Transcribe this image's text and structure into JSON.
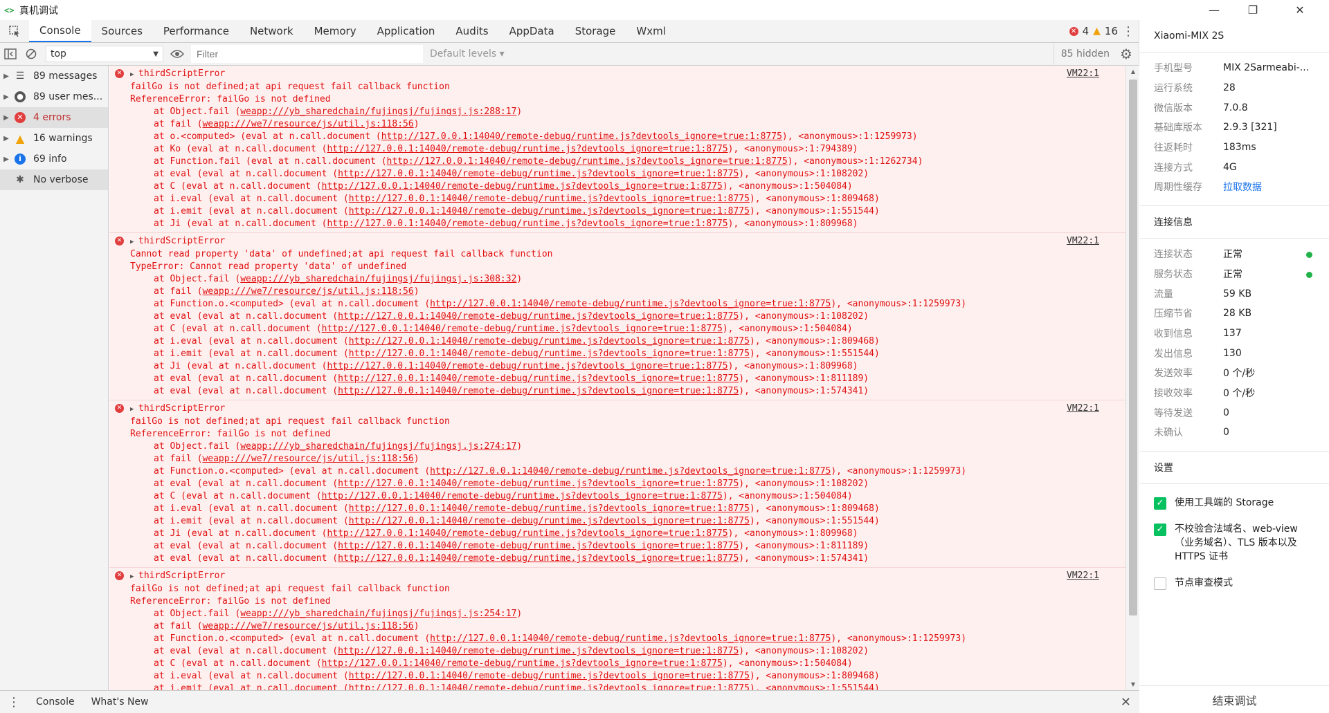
{
  "window": {
    "title": "真机调试",
    "logo_text": "<>",
    "minimize_label": "—",
    "maximize_label": "❐",
    "close_label": "✕"
  },
  "tabs": [
    {
      "label": "Console",
      "active": true
    },
    {
      "label": "Sources"
    },
    {
      "label": "Performance"
    },
    {
      "label": "Network"
    },
    {
      "label": "Memory"
    },
    {
      "label": "Application"
    },
    {
      "label": "Audits"
    },
    {
      "label": "AppData"
    },
    {
      "label": "Storage"
    },
    {
      "label": "Wxml"
    }
  ],
  "counters": {
    "errors": "4",
    "warnings": "16"
  },
  "toolbar": {
    "context": "top",
    "filter_placeholder": "Filter",
    "levels": "Default levels",
    "hidden": "85 hidden"
  },
  "sidebar": {
    "items": [
      {
        "label": "89 messages",
        "icon": "list-icon"
      },
      {
        "label": "89 user mes...",
        "icon": "user-icon"
      },
      {
        "label": "4 errors",
        "icon": "error-icon"
      },
      {
        "label": "16 warnings",
        "icon": "warning-icon"
      },
      {
        "label": "69 info",
        "icon": "info-icon"
      },
      {
        "label": "No verbose",
        "icon": "bug-icon"
      }
    ]
  },
  "messages": [
    {
      "title": "thirdScriptError",
      "source": "VM22:1",
      "lines": [
        "failGo is not defined;at api request fail callback function",
        "ReferenceError: failGo is not defined"
      ],
      "frames": [
        {
          "pre": "at Object.fail (",
          "link": "weapp:///yb_sharedchain/fujingsj/fujingsj.js:288:17",
          "post": ")"
        },
        {
          "pre": "at fail (",
          "link": "weapp:///we7/resource/js/util.js:118:56",
          "post": ")"
        },
        {
          "pre": "at o.<computed> (eval at n.call.document (",
          "link": "http://127.0.0.1:14040/remote-debug/runtime.js?devtools_ignore=true:1:8775",
          "post": "), <anonymous>:1:1259973)"
        },
        {
          "pre": "at Ko (eval at n.call.document (",
          "link": "http://127.0.0.1:14040/remote-debug/runtime.js?devtools_ignore=true:1:8775",
          "post": "), <anonymous>:1:794389)"
        },
        {
          "pre": "at Function.fail (eval at n.call.document (",
          "link": "http://127.0.0.1:14040/remote-debug/runtime.js?devtools_ignore=true:1:8775",
          "post": "), <anonymous>:1:1262734)"
        },
        {
          "pre": "at eval (eval at n.call.document (",
          "link": "http://127.0.0.1:14040/remote-debug/runtime.js?devtools_ignore=true:1:8775",
          "post": "), <anonymous>:1:108202)"
        },
        {
          "pre": "at C (eval at n.call.document (",
          "link": "http://127.0.0.1:14040/remote-debug/runtime.js?devtools_ignore=true:1:8775",
          "post": "), <anonymous>:1:504084)"
        },
        {
          "pre": "at i.eval (eval at n.call.document (",
          "link": "http://127.0.0.1:14040/remote-debug/runtime.js?devtools_ignore=true:1:8775",
          "post": "), <anonymous>:1:809468)"
        },
        {
          "pre": "at i.emit (eval at n.call.document (",
          "link": "http://127.0.0.1:14040/remote-debug/runtime.js?devtools_ignore=true:1:8775",
          "post": "), <anonymous>:1:551544)"
        },
        {
          "pre": "at Ji (eval at n.call.document (",
          "link": "http://127.0.0.1:14040/remote-debug/runtime.js?devtools_ignore=true:1:8775",
          "post": "), <anonymous>:1:809968)"
        }
      ]
    },
    {
      "title": "thirdScriptError",
      "source": "VM22:1",
      "lines": [
        "Cannot read property 'data' of undefined;at api request fail callback function",
        "TypeError: Cannot read property 'data' of undefined"
      ],
      "frames": [
        {
          "pre": "at Object.fail (",
          "link": "weapp:///yb_sharedchain/fujingsj/fujingsj.js:308:32",
          "post": ")"
        },
        {
          "pre": "at fail (",
          "link": "weapp:///we7/resource/js/util.js:118:56",
          "post": ")"
        },
        {
          "pre": "at Function.o.<computed> (eval at n.call.document (",
          "link": "http://127.0.0.1:14040/remote-debug/runtime.js?devtools_ignore=true:1:8775",
          "post": "), <anonymous>:1:1259973)"
        },
        {
          "pre": "at eval (eval at n.call.document (",
          "link": "http://127.0.0.1:14040/remote-debug/runtime.js?devtools_ignore=true:1:8775",
          "post": "), <anonymous>:1:108202)"
        },
        {
          "pre": "at C (eval at n.call.document (",
          "link": "http://127.0.0.1:14040/remote-debug/runtime.js?devtools_ignore=true:1:8775",
          "post": "), <anonymous>:1:504084)"
        },
        {
          "pre": "at i.eval (eval at n.call.document (",
          "link": "http://127.0.0.1:14040/remote-debug/runtime.js?devtools_ignore=true:1:8775",
          "post": "), <anonymous>:1:809468)"
        },
        {
          "pre": "at i.emit (eval at n.call.document (",
          "link": "http://127.0.0.1:14040/remote-debug/runtime.js?devtools_ignore=true:1:8775",
          "post": "), <anonymous>:1:551544)"
        },
        {
          "pre": "at Ji (eval at n.call.document (",
          "link": "http://127.0.0.1:14040/remote-debug/runtime.js?devtools_ignore=true:1:8775",
          "post": "), <anonymous>:1:809968)"
        },
        {
          "pre": "at eval (eval at n.call.document (",
          "link": "http://127.0.0.1:14040/remote-debug/runtime.js?devtools_ignore=true:1:8775",
          "post": "), <anonymous>:1:811189)"
        },
        {
          "pre": "at eval (eval at n.call.document (",
          "link": "http://127.0.0.1:14040/remote-debug/runtime.js?devtools_ignore=true:1:8775",
          "post": "), <anonymous>:1:574341)"
        }
      ]
    },
    {
      "title": "thirdScriptError",
      "source": "VM22:1",
      "lines": [
        "failGo is not defined;at api request fail callback function",
        "ReferenceError: failGo is not defined"
      ],
      "frames": [
        {
          "pre": "at Object.fail (",
          "link": "weapp:///yb_sharedchain/fujingsj/fujingsj.js:274:17",
          "post": ")"
        },
        {
          "pre": "at fail (",
          "link": "weapp:///we7/resource/js/util.js:118:56",
          "post": ")"
        },
        {
          "pre": "at Function.o.<computed> (eval at n.call.document (",
          "link": "http://127.0.0.1:14040/remote-debug/runtime.js?devtools_ignore=true:1:8775",
          "post": "), <anonymous>:1:1259973)"
        },
        {
          "pre": "at eval (eval at n.call.document (",
          "link": "http://127.0.0.1:14040/remote-debug/runtime.js?devtools_ignore=true:1:8775",
          "post": "), <anonymous>:1:108202)"
        },
        {
          "pre": "at C (eval at n.call.document (",
          "link": "http://127.0.0.1:14040/remote-debug/runtime.js?devtools_ignore=true:1:8775",
          "post": "), <anonymous>:1:504084)"
        },
        {
          "pre": "at i.eval (eval at n.call.document (",
          "link": "http://127.0.0.1:14040/remote-debug/runtime.js?devtools_ignore=true:1:8775",
          "post": "), <anonymous>:1:809468)"
        },
        {
          "pre": "at i.emit (eval at n.call.document (",
          "link": "http://127.0.0.1:14040/remote-debug/runtime.js?devtools_ignore=true:1:8775",
          "post": "), <anonymous>:1:551544)"
        },
        {
          "pre": "at Ji (eval at n.call.document (",
          "link": "http://127.0.0.1:14040/remote-debug/runtime.js?devtools_ignore=true:1:8775",
          "post": "), <anonymous>:1:809968)"
        },
        {
          "pre": "at eval (eval at n.call.document (",
          "link": "http://127.0.0.1:14040/remote-debug/runtime.js?devtools_ignore=true:1:8775",
          "post": "), <anonymous>:1:811189)"
        },
        {
          "pre": "at eval (eval at n.call.document (",
          "link": "http://127.0.0.1:14040/remote-debug/runtime.js?devtools_ignore=true:1:8775",
          "post": "), <anonymous>:1:574341)"
        }
      ]
    },
    {
      "title": "thirdScriptError",
      "source": "VM22:1",
      "lines": [
        "failGo is not defined;at api request fail callback function",
        "ReferenceError: failGo is not defined"
      ],
      "frames": [
        {
          "pre": "at Object.fail (",
          "link": "weapp:///yb_sharedchain/fujingsj/fujingsj.js:254:17",
          "post": ")"
        },
        {
          "pre": "at fail (",
          "link": "weapp:///we7/resource/js/util.js:118:56",
          "post": ")"
        },
        {
          "pre": "at Function.o.<computed> (eval at n.call.document (",
          "link": "http://127.0.0.1:14040/remote-debug/runtime.js?devtools_ignore=true:1:8775",
          "post": "), <anonymous>:1:1259973)"
        },
        {
          "pre": "at eval (eval at n.call.document (",
          "link": "http://127.0.0.1:14040/remote-debug/runtime.js?devtools_ignore=true:1:8775",
          "post": "), <anonymous>:1:108202)"
        },
        {
          "pre": "at C (eval at n.call.document (",
          "link": "http://127.0.0.1:14040/remote-debug/runtime.js?devtools_ignore=true:1:8775",
          "post": "), <anonymous>:1:504084)"
        },
        {
          "pre": "at i.eval (eval at n.call.document (",
          "link": "http://127.0.0.1:14040/remote-debug/runtime.js?devtools_ignore=true:1:8775",
          "post": "), <anonymous>:1:809468)"
        },
        {
          "pre": "at i.emit (eval at n.call.document (",
          "link": "http://127.0.0.1:14040/remote-debug/runtime.js?devtools_ignore=true:1:8775",
          "post": "), <anonymous>:1:551544)"
        }
      ]
    }
  ],
  "drawer": {
    "tabs": [
      "Console",
      "What's New"
    ]
  },
  "device": {
    "name": "Xiaomi-MIX 2S",
    "info": [
      {
        "k": "手机型号",
        "v": "MIX 2Sarmeabi-..."
      },
      {
        "k": "运行系统",
        "v": "28"
      },
      {
        "k": "微信版本",
        "v": "7.0.8"
      },
      {
        "k": "基础库版本",
        "v": "2.9.3 [321]"
      },
      {
        "k": "往返耗时",
        "v": "183ms"
      },
      {
        "k": "连接方式",
        "v": "4G"
      },
      {
        "k": "周期性缓存",
        "v": "拉取数据",
        "link": true
      }
    ],
    "conn_title": "连接信息",
    "conn": [
      {
        "k": "连接状态",
        "v": "正常",
        "dot": true
      },
      {
        "k": "服务状态",
        "v": "正常",
        "dot": true
      },
      {
        "k": "流量",
        "v": "59 KB"
      },
      {
        "k": "压缩节省",
        "v": "28 KB"
      },
      {
        "k": "收到信息",
        "v": "137"
      },
      {
        "k": "发出信息",
        "v": "130"
      },
      {
        "k": "发送效率",
        "v": "0 个/秒"
      },
      {
        "k": "接收效率",
        "v": "0 个/秒"
      },
      {
        "k": "等待发送",
        "v": "0"
      },
      {
        "k": "未确认",
        "v": "0"
      }
    ],
    "settings_title": "设置",
    "settings": [
      {
        "label": "使用工具端的 Storage",
        "checked": true
      },
      {
        "label": "不校验合法域名、web-view（业务域名）、TLS 版本以及 HTTPS 证书",
        "checked": true
      },
      {
        "label": "节点审查模式",
        "checked": false
      }
    ],
    "end_button": "结束调试"
  },
  "colors": {
    "accent": "#1a73e8",
    "error": "#e13e3e",
    "warning": "#f0a30a",
    "ok": "#07c160"
  }
}
